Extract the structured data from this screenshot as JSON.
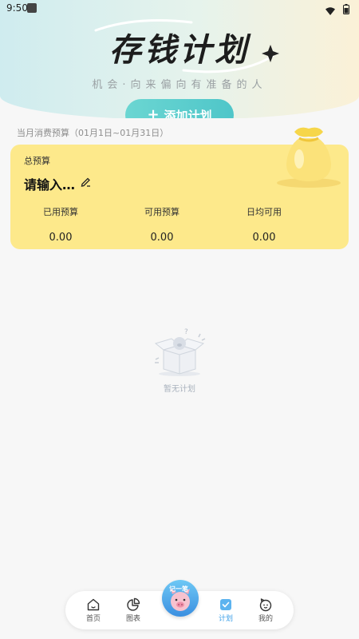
{
  "status_bar": {
    "time": "9:50"
  },
  "header": {
    "title": "存钱计划",
    "subtitle": "机会·向来偏向有准备的人",
    "add_plan_label": "添加计划"
  },
  "budget": {
    "period": "当月消费预算（01月1日~01月31日）",
    "card_title": "总预算",
    "name_value": "请输入…",
    "stats": [
      {
        "label": "已用预算",
        "value": "0.00"
      },
      {
        "label": "可用预算",
        "value": "0.00"
      },
      {
        "label": "日均可用",
        "value": "0.00"
      }
    ]
  },
  "empty_state": {
    "text": "暂无计划"
  },
  "nav": {
    "items": [
      {
        "label": "首页",
        "icon": "home-icon"
      },
      {
        "label": "图表",
        "icon": "pie-chart-icon"
      },
      {
        "label": "计划",
        "icon": "checkbox-icon",
        "active": true
      },
      {
        "label": "我的",
        "icon": "smiley-icon"
      }
    ],
    "record_label": "记一笔"
  },
  "colors": {
    "card_bg": "#fde98b",
    "accent_teal": "#4fc6c9",
    "nav_active": "#3da0e8"
  }
}
